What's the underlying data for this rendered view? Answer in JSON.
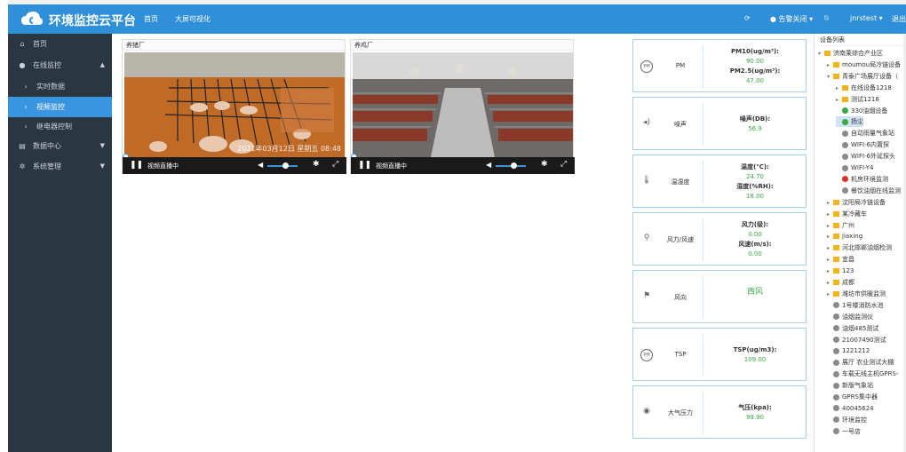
{
  "header": {
    "app_title": "环境监控云平台",
    "nav": [
      "首页",
      "大屏可视化"
    ],
    "alarm_label": "告警关闭",
    "user": "jnrstest",
    "logout": "退出"
  },
  "sidebar": {
    "items": [
      {
        "label": "首页",
        "icon": "home-icon",
        "active": false,
        "sub": false,
        "arrow": ""
      },
      {
        "label": "在线监控",
        "icon": "globe-icon",
        "active": false,
        "sub": false,
        "arrow": "▲"
      },
      {
        "label": "实时数据",
        "icon": "chevron-right-icon",
        "active": false,
        "sub": true,
        "arrow": ""
      },
      {
        "label": "视频监控",
        "icon": "chevron-right-icon",
        "active": true,
        "sub": true,
        "arrow": ""
      },
      {
        "label": "继电器控制",
        "icon": "chevron-right-icon",
        "active": false,
        "sub": true,
        "arrow": ""
      },
      {
        "label": "数据中心",
        "icon": "table-icon",
        "active": false,
        "sub": false,
        "arrow": "▼"
      },
      {
        "label": "系统管理",
        "icon": "gear-icon",
        "active": false,
        "sub": false,
        "arrow": "▼"
      }
    ]
  },
  "videos": [
    {
      "title": "养猪厂",
      "status": "视频直播中",
      "timestamp": "2021年03月12日 星期五 08:48"
    },
    {
      "title": "养鸡厂",
      "status": "视频直播中",
      "timestamp": ""
    }
  ],
  "sensors": [
    {
      "name": "PM",
      "icon": "pm-icon",
      "glyph": "PM",
      "values": [
        {
          "k": "PM10(ug/m³):",
          "v": "90.00"
        },
        {
          "k": "PM2.5(ug/m³):",
          "v": "47.00"
        }
      ]
    },
    {
      "name": "噪声",
      "icon": "speaker-icon",
      "glyph": "◂)",
      "values": [
        {
          "k": "噪声(DB):",
          "v": "56.9"
        }
      ]
    },
    {
      "name": "温湿度",
      "icon": "thermometer-icon",
      "glyph": "🌡",
      "values": [
        {
          "k": "温度(℃):",
          "v": "24.70"
        },
        {
          "k": "湿度(%RH):",
          "v": "18.00"
        }
      ]
    },
    {
      "name": "风力/风速",
      "icon": "anemometer-icon",
      "glyph": "⚲",
      "values": [
        {
          "k": "风力(级):",
          "v": "0.00"
        },
        {
          "k": "风速(m/s):",
          "v": "0.00"
        }
      ]
    },
    {
      "name": "风向",
      "icon": "flag-icon",
      "glyph": "⚑",
      "values": [
        {
          "k": "",
          "v": "西风"
        }
      ]
    },
    {
      "name": "TSP",
      "icon": "tsp-icon",
      "glyph": "PM",
      "values": [
        {
          "k": "TSP(ug/m3):",
          "v": "109.00"
        }
      ]
    },
    {
      "name": "大气压力",
      "icon": "gauge-icon",
      "glyph": "◉",
      "values": [
        {
          "k": "气压(kpa):",
          "v": "99.90"
        }
      ]
    }
  ],
  "device_tree": {
    "title": "设备列表",
    "nodes": [
      {
        "label": "济南莱综合产业区",
        "type": "folder",
        "level": 0,
        "exp": "▾"
      },
      {
        "label": "moumou局冷链设备",
        "type": "folder",
        "level": 1,
        "exp": "▸"
      },
      {
        "label": "青泰广场展厅设备（",
        "type": "folder",
        "level": 1,
        "exp": "▾"
      },
      {
        "label": "在线设备1218",
        "type": "folder",
        "level": 2,
        "exp": "▸"
      },
      {
        "label": "测试1218",
        "type": "folder",
        "level": 2,
        "exp": "▸"
      },
      {
        "label": "330油烟设备",
        "type": "green",
        "level": 2,
        "exp": ""
      },
      {
        "label": "扬尘",
        "type": "green",
        "level": 2,
        "exp": "",
        "sel": true
      },
      {
        "label": "自动雨量气象站",
        "type": "gray",
        "level": 2,
        "exp": ""
      },
      {
        "label": "WIFI-6内置探",
        "type": "gray",
        "level": 2,
        "exp": ""
      },
      {
        "label": "WIFI-6外延探头",
        "type": "gray",
        "level": 2,
        "exp": ""
      },
      {
        "label": "WIFI-Y4",
        "type": "gray",
        "level": 2,
        "exp": ""
      },
      {
        "label": "机房环境监测",
        "type": "red",
        "level": 2,
        "exp": ""
      },
      {
        "label": "餐饮油烟在线监测",
        "type": "gray",
        "level": 2,
        "exp": ""
      },
      {
        "label": "沈阳局冷链设备",
        "type": "folder",
        "level": 1,
        "exp": "▸"
      },
      {
        "label": "某冷藏车",
        "type": "folder",
        "level": 1,
        "exp": "▸"
      },
      {
        "label": "广州",
        "type": "folder",
        "level": 1,
        "exp": "▸"
      },
      {
        "label": "jiaxing",
        "type": "folder",
        "level": 1,
        "exp": "▸"
      },
      {
        "label": "河北邯郸油烟检测",
        "type": "folder",
        "level": 1,
        "exp": "▸"
      },
      {
        "label": "宜昌",
        "type": "folder",
        "level": 1,
        "exp": "▸"
      },
      {
        "label": "123",
        "type": "folder",
        "level": 1,
        "exp": "▸"
      },
      {
        "label": "成都",
        "type": "folder",
        "level": 1,
        "exp": "▸"
      },
      {
        "label": "潍坊市供暖监测",
        "type": "folder",
        "level": 1,
        "exp": "▸"
      },
      {
        "label": "1号楼消防水池",
        "type": "gray",
        "level": 1,
        "exp": ""
      },
      {
        "label": "油烟监测仪",
        "type": "gray",
        "level": 1,
        "exp": ""
      },
      {
        "label": "油烟485测试",
        "type": "gray",
        "level": 1,
        "exp": ""
      },
      {
        "label": "21007490测试",
        "type": "gray",
        "level": 1,
        "exp": ""
      },
      {
        "label": "1221212",
        "type": "gray",
        "level": 1,
        "exp": ""
      },
      {
        "label": "展厅 农业测试大棚",
        "type": "gray",
        "level": 1,
        "exp": ""
      },
      {
        "label": "车载无线主机GPRS-",
        "type": "gray",
        "level": 1,
        "exp": ""
      },
      {
        "label": "新版气象站",
        "type": "gray",
        "level": 1,
        "exp": ""
      },
      {
        "label": "GPRS集中器",
        "type": "gray",
        "level": 1,
        "exp": ""
      },
      {
        "label": "40045624",
        "type": "gray",
        "level": 1,
        "exp": ""
      },
      {
        "label": "环境监控",
        "type": "gray",
        "level": 1,
        "exp": ""
      },
      {
        "label": "一号店",
        "type": "gray",
        "level": 1,
        "exp": ""
      }
    ]
  }
}
